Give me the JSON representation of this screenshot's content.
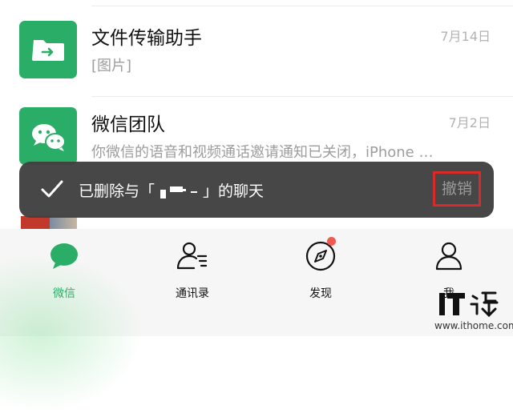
{
  "chats": [
    {
      "title": "文件传输助手",
      "preview": "[图片]",
      "time": "7月14日",
      "avatar_icon": "folder-arrow-icon",
      "avatar_color": "#2aae67"
    },
    {
      "title": "微信团队",
      "preview": "你微信的语音和视频通话邀请通知已关闭，iPhone …",
      "time": "7月2日",
      "avatar_icon": "wechat-bubbles-icon",
      "avatar_color": "#2aae67"
    }
  ],
  "toast": {
    "message_prefix": "已删除与「",
    "message_suffix": "」的聊天",
    "undo_label": "撤销",
    "check_icon": "check-icon"
  },
  "tabs": [
    {
      "label": "微信",
      "icon": "chat-bubble-icon",
      "active": true
    },
    {
      "label": "通讯录",
      "icon": "contacts-icon"
    },
    {
      "label": "发现",
      "icon": "compass-icon",
      "badge": "red-dot"
    },
    {
      "label": "我",
      "icon": "person-icon"
    }
  ],
  "watermark": {
    "url": "www.ithome.com"
  },
  "colors": {
    "accent_green": "#2aae67",
    "toast_bg": "#404040",
    "highlight_red": "#d92a2a",
    "badge_red": "#f15a51"
  }
}
